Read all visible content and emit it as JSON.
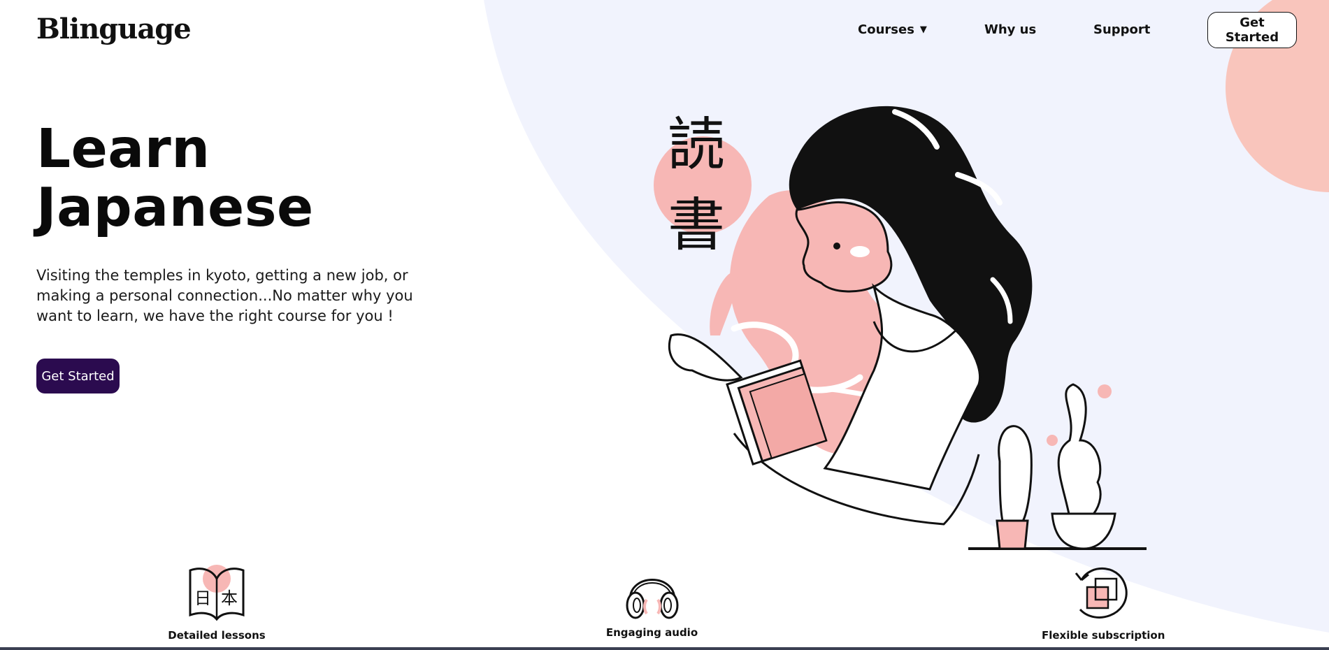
{
  "brand": {
    "name": "Blinguage"
  },
  "nav": {
    "courses": "Courses",
    "why": "Why us",
    "support": "Support",
    "cta": "Get Started"
  },
  "hero": {
    "title_line1": "Learn",
    "title_line2": "Japanese",
    "description": "Visiting the temples in kyoto, getting a new job, or making a personal connection...No matter why you want to learn, we have the right course for you !",
    "cta": "Get Started",
    "kanji_top": "読",
    "kanji_bottom": "書"
  },
  "features": [
    {
      "label": "Detailed lessons",
      "icon": "open-book-icon",
      "glyph_left": "日",
      "glyph_right": "本"
    },
    {
      "label": "Engaging audio",
      "icon": "headphones-icon"
    },
    {
      "label": "Flexible subscription",
      "icon": "cycle-squares-icon"
    }
  ],
  "colors": {
    "accent_pink": "#f7b7b5",
    "background_lavender": "#f1f3fd",
    "cta_purple": "#2b0b4f",
    "ink": "#111111"
  }
}
